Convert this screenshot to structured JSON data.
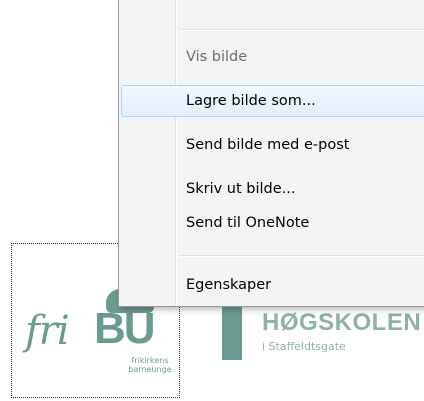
{
  "background": {
    "fribu_logo": {
      "script_text": "fri",
      "block_text": "BU",
      "subtitle_line1": "frikirkens",
      "subtitle_line2": "barneunge",
      "color": "#6b9a91"
    },
    "hogskolen_logo": {
      "title": "HØGSKOLEN",
      "subtitle": "i Staffeldtsgate",
      "color": "#8fb1ab"
    }
  },
  "context_menu": {
    "items": [
      {
        "label": "Vis bilde",
        "state": "disabled"
      },
      {
        "label": "Lagre bilde som...",
        "state": "hover"
      },
      {
        "label": "Send bilde med e-post",
        "state": "normal"
      },
      {
        "label": "Skriv ut bilde...",
        "state": "normal"
      },
      {
        "label": "Send til OneNote",
        "state": "normal"
      },
      {
        "label": "Egenskaper",
        "state": "normal"
      }
    ],
    "colors": {
      "background": "#f4f4f4",
      "border": "#979797",
      "hover_border": "#aecff7",
      "disabled_text": "#6d6d6d"
    }
  }
}
